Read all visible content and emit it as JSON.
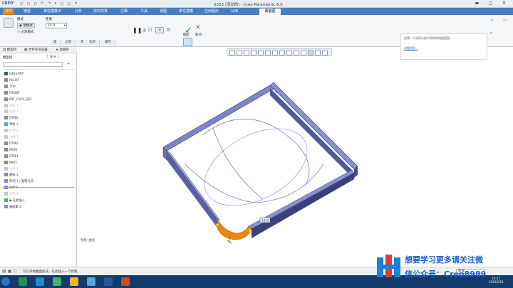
{
  "titlebar": {
    "logo": "CREO°",
    "title": "0303 (活动的) - Creo Parametric 6.0"
  },
  "tabs": [
    "文件",
    "模型",
    "柔性建模卡",
    "分析",
    "实时仿真",
    "注释",
    "工具",
    "视图",
    "柔性建模",
    "应用程序",
    "公用",
    "曲面图"
  ],
  "ribbon": {
    "mode_label": "模式",
    "mode_options": [
      "草模式",
      "过渡模式"
    ],
    "spacing_label": "距离",
    "spacing_value": "15.0",
    "confirm_label": "确定",
    "cancel_label": "取消",
    "subtabs": [
      "集",
      "过渡",
      "角",
      "选项",
      "属性"
    ],
    "help_text": "选择一个选项以定义如何修改曲面图。",
    "help_link": "详细信息..."
  },
  "left_panel": {
    "tabs": [
      "模型树",
      "文件夹浏览器",
      "收藏夹"
    ],
    "tree_header": "模型树",
    "items": [
      {
        "label": "0303.PRT",
        "dim": false
      },
      {
        "label": "RIGHT",
        "dim": false
      },
      {
        "label": "TOP",
        "dim": false
      },
      {
        "label": "FRONT",
        "dim": false
      },
      {
        "label": "PRT_CSYS_DEF",
        "dim": false
      },
      {
        "label": "草绘 1",
        "dim": true
      },
      {
        "label": "拉伸 1",
        "dim": true
      },
      {
        "label": "DTM1",
        "dim": false
      },
      {
        "label": "草绘 2",
        "dim": false
      },
      {
        "label": "拉伸 2",
        "dim": true
      },
      {
        "label": "拉伸 3",
        "dim": true
      },
      {
        "label": "DTM2",
        "dim": false
      },
      {
        "label": "PNT0",
        "dim": false
      },
      {
        "label": "DTM3",
        "dim": false
      },
      {
        "label": "PNT1",
        "dim": false
      },
      {
        "label": "拉伸 4",
        "dim": true
      },
      {
        "label": "曲面 1",
        "dim": false
      },
      {
        "label": "阵列 1 / 复制几何",
        "dim": false
      },
      {
        "label": "拉伸 5",
        "dim": false
      },
      {
        "label": "复制 1",
        "dim": true
      },
      {
        "label": "◆ 在此插入",
        "dim": false
      },
      {
        "label": "曲面集 2",
        "dim": false
      }
    ]
  },
  "viewport": {
    "dimension_value": "15.0",
    "smart_label": "智能: 曲面"
  },
  "status": {
    "message": "可以开始曲面加法，在此插入一个新集。",
    "filter": "智能"
  },
  "watermark": {
    "line1": "想要学习更多请关注微",
    "line2": "信公众号：Creo8989"
  },
  "taskbar": {
    "time": "16:27",
    "date": "2020/2/18"
  },
  "colors": {
    "ribbon_blue": "#4a7cc0",
    "file_tab": "#e2851f",
    "part_face": "#7f86c8",
    "part_dark": "#3e4278",
    "highlight": "#e88a10"
  }
}
